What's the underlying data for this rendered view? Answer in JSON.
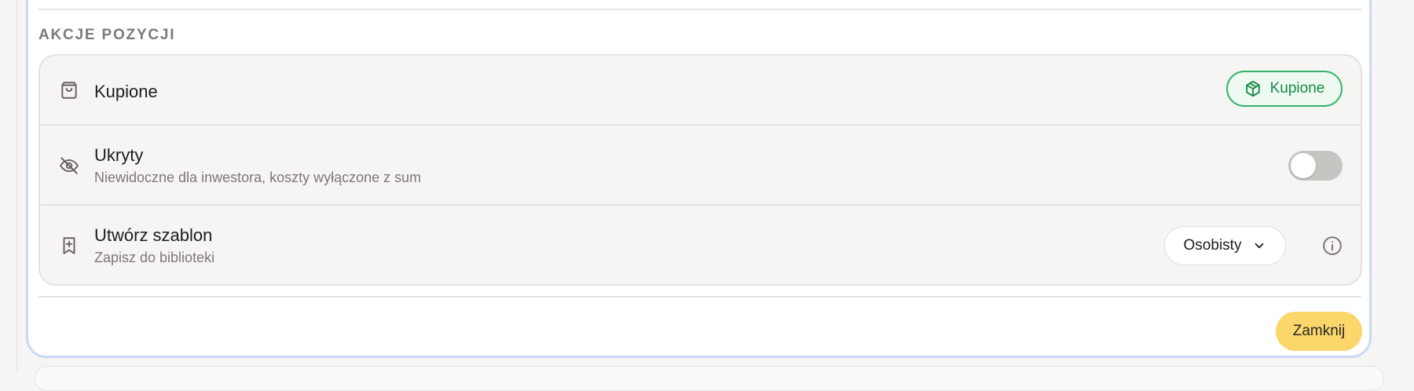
{
  "section": {
    "title": "AKCJE POZYCJI"
  },
  "rows": [
    {
      "icon": "shopping-bag-icon",
      "title": "Kupione",
      "action": {
        "type": "status-pill",
        "label": "Kupione",
        "icon": "package-icon",
        "color": "#158a45",
        "background": "#eef9f2",
        "border": "#35b36a"
      }
    },
    {
      "icon": "eye-off-icon",
      "title": "Ukryty",
      "subtitle": "Niewidoczne dla inwestora, koszty wyłączone z sum",
      "action": {
        "type": "toggle",
        "checked": false
      }
    },
    {
      "icon": "bookmark-plus-icon",
      "title": "Utwórz szablon",
      "subtitle": "Zapisz do biblioteki",
      "action": {
        "type": "dropdown",
        "selected": "Osobisty",
        "icon": "chevron-down-icon",
        "secondary_icon": "info-icon"
      }
    }
  ],
  "footer": {
    "close_label": "Zamknij",
    "close_color": "#fad66b"
  },
  "colors": {
    "panel_border": "#c9d9f2",
    "card_background": "#f6f5f3",
    "text_primary": "#1f1d1b",
    "text_secondary": "#7c7874"
  }
}
